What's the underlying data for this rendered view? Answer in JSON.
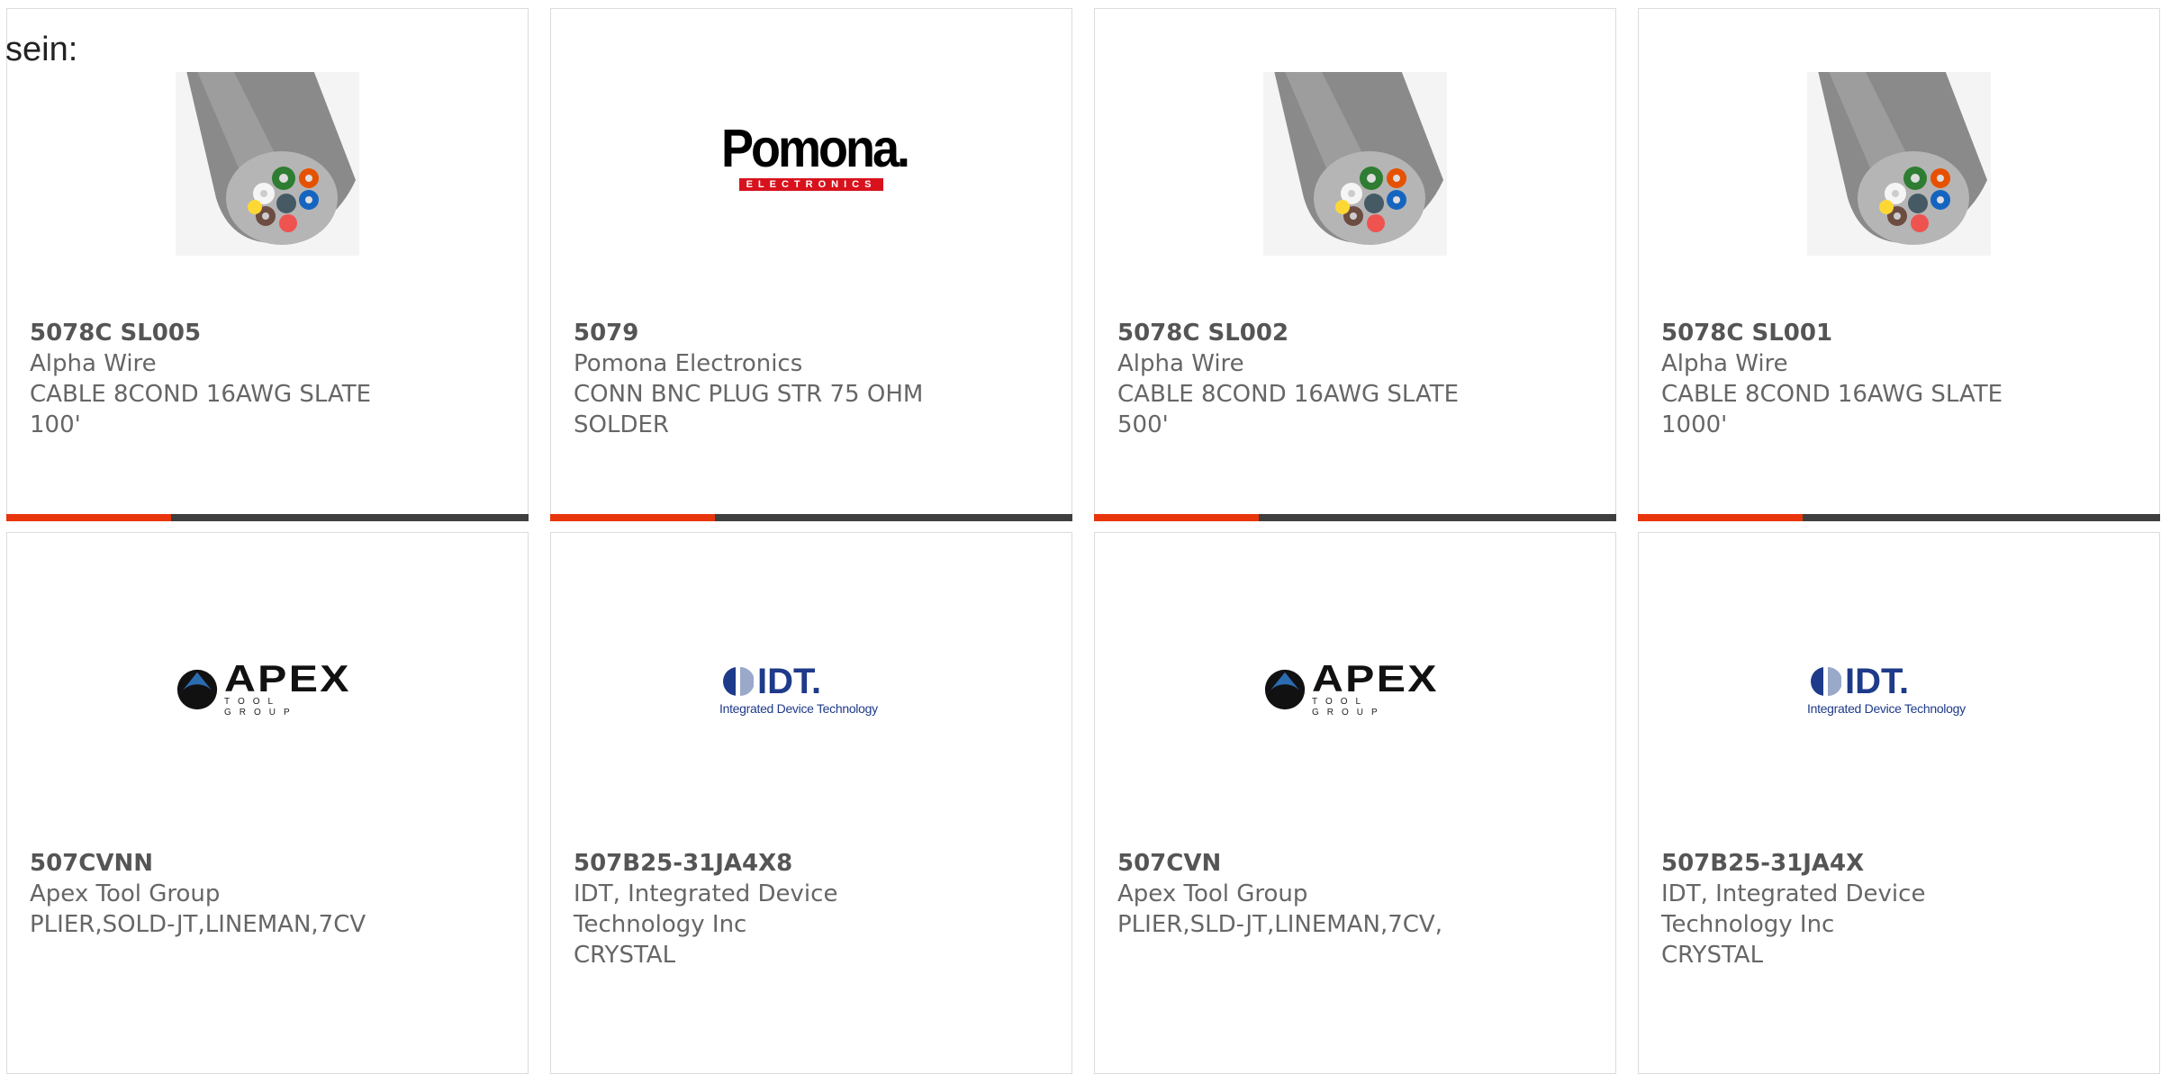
{
  "intro_text": "sein:",
  "colors": {
    "accent": "#e8350c",
    "bar": "#3f3f3f",
    "border": "#dcdcdc",
    "text": "#666666"
  },
  "products": [
    {
      "part_number": "5078C SL005",
      "manufacturer": "Alpha Wire",
      "description": "CABLE 8COND 16AWG SLATE 100'",
      "image": "cable-image"
    },
    {
      "part_number": "5079",
      "manufacturer": "Pomona Electronics",
      "description": "CONN BNC PLUG STR 75 OHM SOLDER",
      "image": "pomona-logo",
      "logo_word": "Pomona.",
      "logo_sub": "ELECTRONICS"
    },
    {
      "part_number": "5078C SL002",
      "manufacturer": "Alpha Wire",
      "description": "CABLE 8COND 16AWG SLATE 500'",
      "image": "cable-image"
    },
    {
      "part_number": "5078C SL001",
      "manufacturer": "Alpha Wire",
      "description": "CABLE 8COND 16AWG SLATE 1000'",
      "image": "cable-image"
    },
    {
      "part_number": "507CVNN",
      "manufacturer": "Apex Tool Group",
      "description": "PLIER,SOLD-JT,LINEMAN,7CV",
      "image": "apex-logo",
      "logo_word": "APEX",
      "logo_sub": "TOOL GROUP"
    },
    {
      "part_number": "507B25-31JA4X8",
      "manufacturer": "IDT, Integrated Device Technology Inc",
      "description": "CRYSTAL",
      "image": "idt-logo",
      "logo_word": "IDT.",
      "logo_sub": "Integrated Device Technology"
    },
    {
      "part_number": "507CVN",
      "manufacturer": "Apex Tool Group",
      "description": "PLIER,SLD-JT,LINEMAN,7CV,",
      "image": "apex-logo",
      "logo_word": "APEX",
      "logo_sub": "TOOL GROUP"
    },
    {
      "part_number": "507B25-31JA4X",
      "manufacturer": "IDT, Integrated Device Technology Inc",
      "description": "CRYSTAL",
      "image": "idt-logo",
      "logo_word": "IDT.",
      "logo_sub": "Integrated Device Technology"
    }
  ]
}
